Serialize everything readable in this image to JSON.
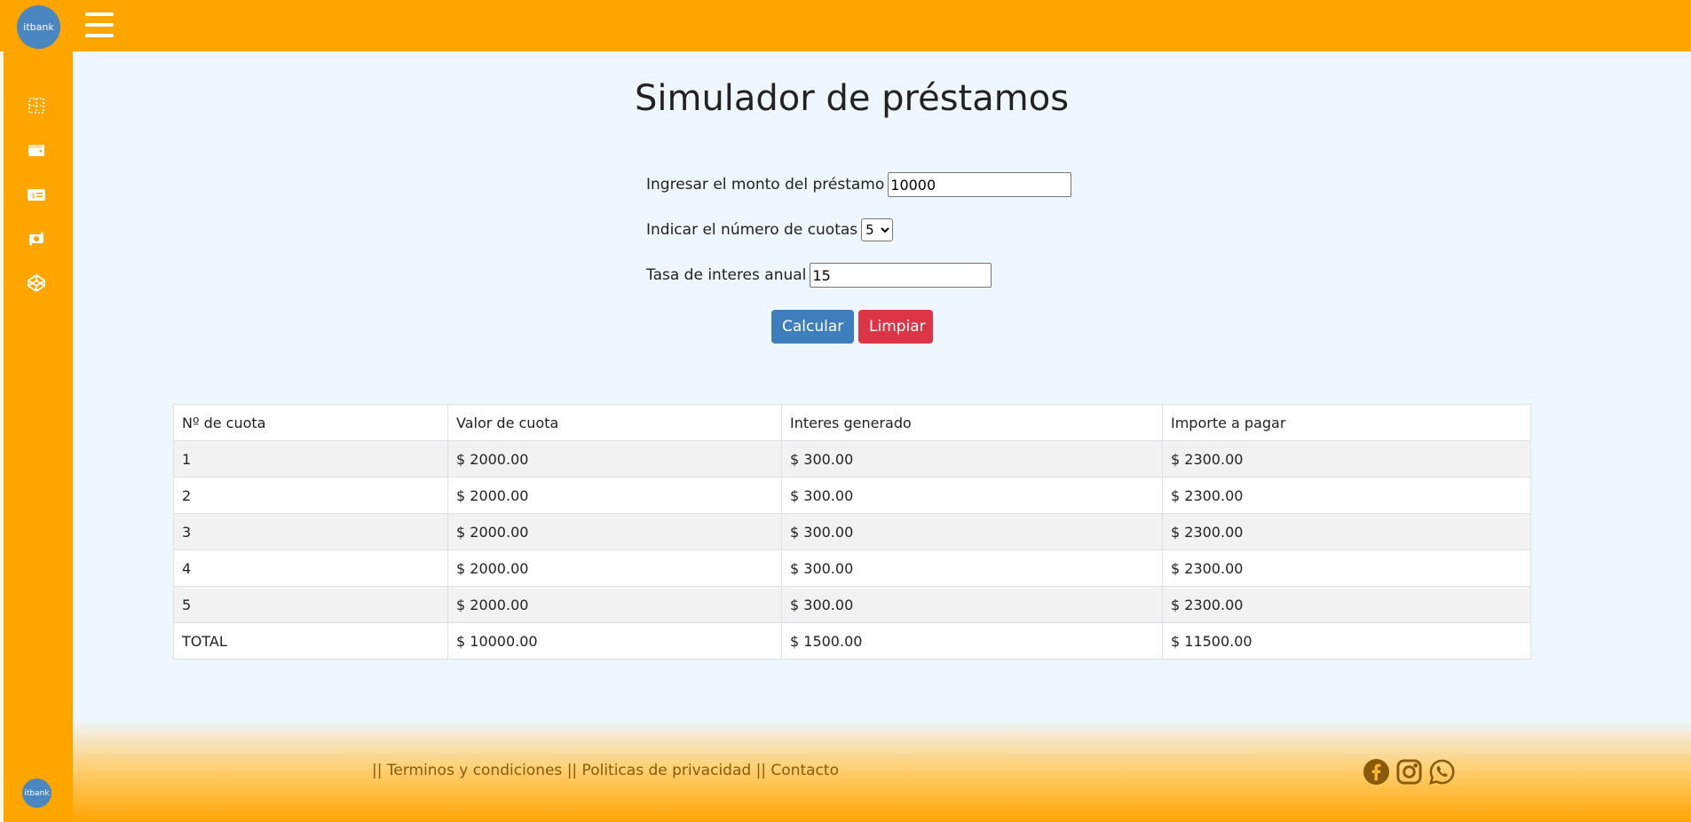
{
  "app": {
    "logo_text": "itbank"
  },
  "sidebar": {
    "items": [
      {
        "icon": "grid-icon"
      },
      {
        "icon": "wallet-icon"
      },
      {
        "icon": "money-card-icon"
      },
      {
        "icon": "exchange-icon"
      },
      {
        "icon": "codepen-icon"
      }
    ],
    "bottom_logo_text": "itbank"
  },
  "page": {
    "title": "Simulador de préstamos"
  },
  "form": {
    "amount_label": "Ingresar el monto del préstamo",
    "amount_value": "10000",
    "installments_label": "Indicar el número de cuotas",
    "installments_value": "5",
    "rate_label": "Tasa de interes anual",
    "rate_value": "15",
    "calc_button": "Calcular",
    "clear_button": "Limpiar"
  },
  "table": {
    "headers": [
      "Nº de cuota",
      "Valor de cuota",
      "Interes generado",
      "Importe a pagar"
    ],
    "rows": [
      [
        "1",
        "$ 2000.00",
        "$ 300.00",
        "$ 2300.00"
      ],
      [
        "2",
        "$ 2000.00",
        "$ 300.00",
        "$ 2300.00"
      ],
      [
        "3",
        "$ 2000.00",
        "$ 300.00",
        "$ 2300.00"
      ],
      [
        "4",
        "$ 2000.00",
        "$ 300.00",
        "$ 2300.00"
      ],
      [
        "5",
        "$ 2000.00",
        "$ 300.00",
        "$ 2300.00"
      ],
      [
        "TOTAL",
        "$ 10000.00",
        "$ 1500.00",
        "$ 11500.00"
      ]
    ]
  },
  "footer": {
    "links": [
      "|| Terminos y condiciones | ",
      " | Politicas de privacidad | ",
      " | Contacto"
    ],
    "social": [
      "facebook-icon",
      "instagram-icon",
      "whatsapp-icon"
    ]
  },
  "colors": {
    "brand_orange": "#ffa500",
    "primary_blue": "#3f7ebd",
    "danger_red": "#dc3545",
    "background": "#eef6fe"
  }
}
